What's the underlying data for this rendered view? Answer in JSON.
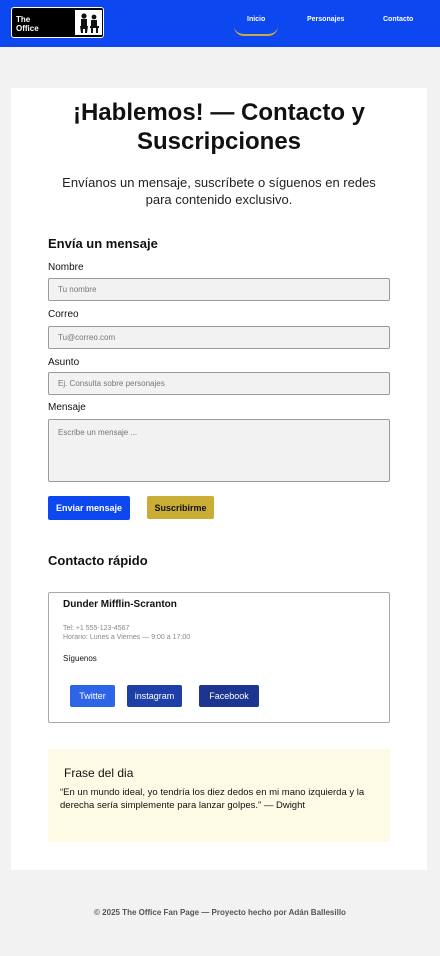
{
  "nav": {
    "logo_line1": "The",
    "logo_line2": "Office",
    "links": [
      "Inicio",
      "Personajes",
      "Contacto"
    ]
  },
  "header": {
    "title": "¡Hablemos! — Contacto y Suscripciones",
    "subtitle": "Envíanos un mensaje, suscríbete o síguenos en redes para contenido exclusivo."
  },
  "form": {
    "heading": "Envía un mensaje",
    "name_label": "Nombre",
    "name_placeholder": "Tu nombre",
    "email_label": "Correo",
    "email_placeholder": "Tu@correo.com",
    "subject_label": "Asunto",
    "subject_placeholder": "Ej. Consulta sobre personajes",
    "message_label": "Mensaje",
    "message_placeholder": "Escribe un mensaje ...",
    "send_label": "Enviar mensaje",
    "subscribe_label": "Suscribirme"
  },
  "quick_contact": {
    "heading": "Contacto rápido",
    "company": "Dunder Mifflin-Scranton",
    "phone": "Tel: +1 555-123-4567",
    "hours": "Horario: Lunes a Viernes — 9:00 a 17:00",
    "follow": "Síguenos",
    "socials": [
      "Twitter",
      "instagram",
      "Facebook"
    ]
  },
  "quote": {
    "title": "Frase del dia",
    "text": "“En un mundo ideal, yo tendría los diez dedos en mi mano izquierda y la derecha sería simplemente para lanzar golpes.” —  Dwight"
  },
  "footer": {
    "text": "© 2025 The Office Fan Page — Proyecto hecho por Adán Ballesillo"
  },
  "colors": {
    "primary_blue": "#0d47f0",
    "gold": "#c9ad35",
    "quote_bg": "#fdfbe6"
  }
}
